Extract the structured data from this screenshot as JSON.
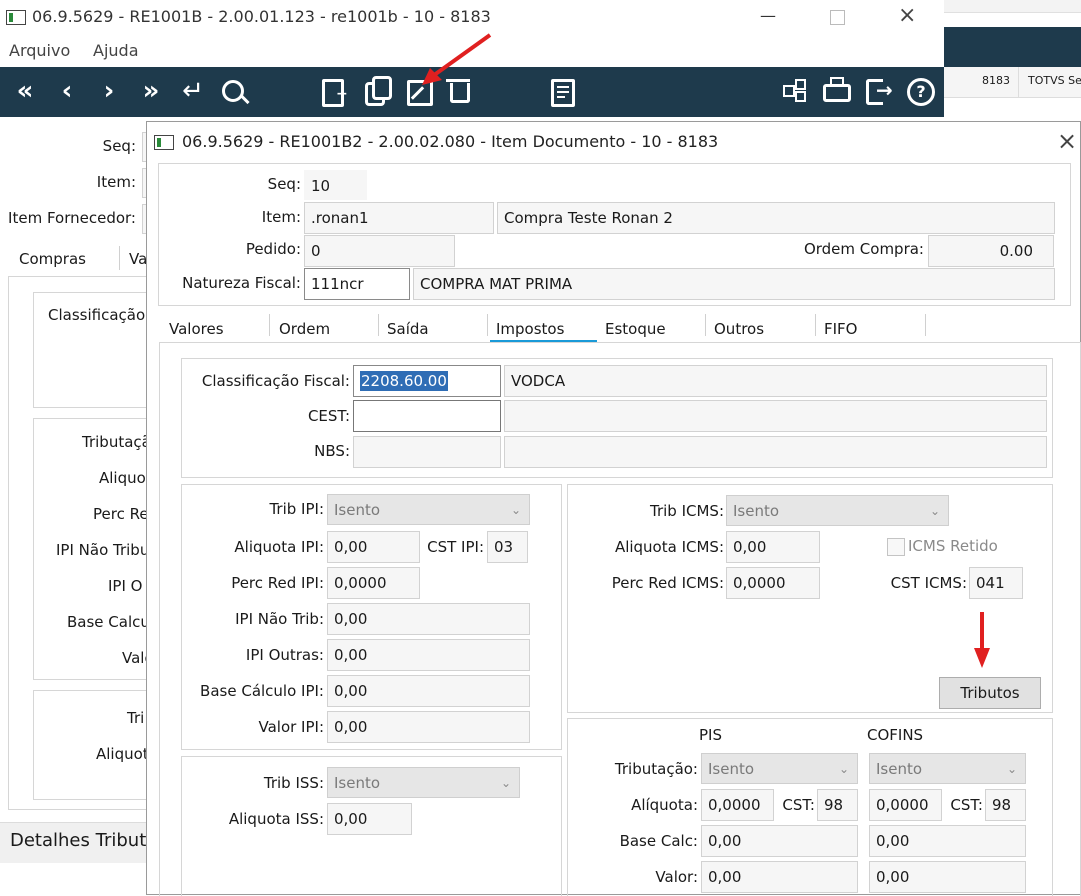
{
  "back_window": {
    "title": "06.9.5629 - RE1001B - 2.00.01.123 - re1001b - 10 - 8183",
    "menu": [
      "Arquivo",
      "Ajuda"
    ],
    "right_tabs": [
      "8183",
      "TOTVS Se"
    ],
    "labels": [
      "Seq:",
      "Item:",
      "Item Fornecedor:"
    ],
    "tabs": [
      "Compras",
      "Va"
    ],
    "inner_labels": [
      "Classificação I",
      "Tributaçã",
      "Aliquot",
      "Perc Re",
      "IPI Não Tribu",
      "IPI O",
      "Base Calcul",
      "Valo",
      "Tri",
      "Aliquot"
    ],
    "footer_text": "Detalhes Tribut"
  },
  "dialog": {
    "title": "06.9.5629 - RE1001B2 - 2.00.02.080 - Item Documento - 10 - 8183",
    "seq_label": "Seq:",
    "seq_value": "10",
    "item_label": "Item:",
    "item_code": ".ronan1",
    "item_desc": "Compra Teste Ronan 2",
    "pedido_label": "Pedido:",
    "pedido_value": "0",
    "ordem_compra_label": "Ordem Compra:",
    "ordem_compra_value": "0.00",
    "natureza_label": "Natureza Fiscal:",
    "natureza_value": "111ncr",
    "natureza_desc": "COMPRA MAT PRIMA",
    "tabs": [
      "Valores",
      "Ordem",
      "Saída",
      "Impostos",
      "Estoque",
      "Outros",
      "FIFO"
    ],
    "active_tab": "Impostos",
    "class_fiscal_label": "Classificação Fiscal:",
    "class_fiscal_value": "2208.60.00",
    "class_fiscal_desc": "VODCA",
    "cest_label": "CEST:",
    "nbs_label": "NBS:",
    "ipi": {
      "trib_label": "Trib IPI:",
      "trib_value": "Isento",
      "aliquota_label": "Aliquota IPI:",
      "aliquota_value": "0,00",
      "cst_label": "CST IPI:",
      "cst_value": "03",
      "perc_red_label": "Perc Red IPI:",
      "perc_red_value": "0,0000",
      "nao_trib_label": "IPI Não Trib:",
      "nao_trib_value": "0,00",
      "outras_label": "IPI Outras:",
      "outras_value": "0,00",
      "base_label": "Base Cálculo IPI:",
      "base_value": "0,00",
      "valor_label": "Valor IPI:",
      "valor_value": "0,00"
    },
    "icms": {
      "trib_label": "Trib ICMS:",
      "trib_value": "Isento",
      "aliquota_label": "Aliquota ICMS:",
      "aliquota_value": "0,00",
      "retido_label": "ICMS Retido",
      "perc_red_label": "Perc Red ICMS:",
      "perc_red_value": "0,0000",
      "cst_label": "CST ICMS:",
      "cst_value": "041",
      "tributos_button": "Tributos"
    },
    "iss": {
      "trib_label": "Trib ISS:",
      "trib_value": "Isento",
      "aliquota_label": "Aliquota ISS:",
      "aliquota_value": "0,00"
    },
    "pis_cofins": {
      "pis_header": "PIS",
      "cofins_header": "COFINS",
      "tributacao_label": "Tributação:",
      "pis_trib": "Isento",
      "cofins_trib": "Isento",
      "aliquota_label": "Alíquota:",
      "pis_aliquota": "0,0000",
      "cofins_aliquota": "0,0000",
      "cst_label": "CST:",
      "pis_cst": "98",
      "cofins_cst": "98",
      "base_label": "Base Calc:",
      "pis_base": "0,00",
      "cofins_base": "0,00",
      "valor_label": "Valor:",
      "pis_valor": "0,00",
      "cofins_valor": "0,00"
    }
  },
  "colors": {
    "toolbar": "#1e3a4c",
    "annotation_arrow": "#e02020",
    "tab_underline": "#1a9ad8",
    "selection": "#2f6db5"
  }
}
